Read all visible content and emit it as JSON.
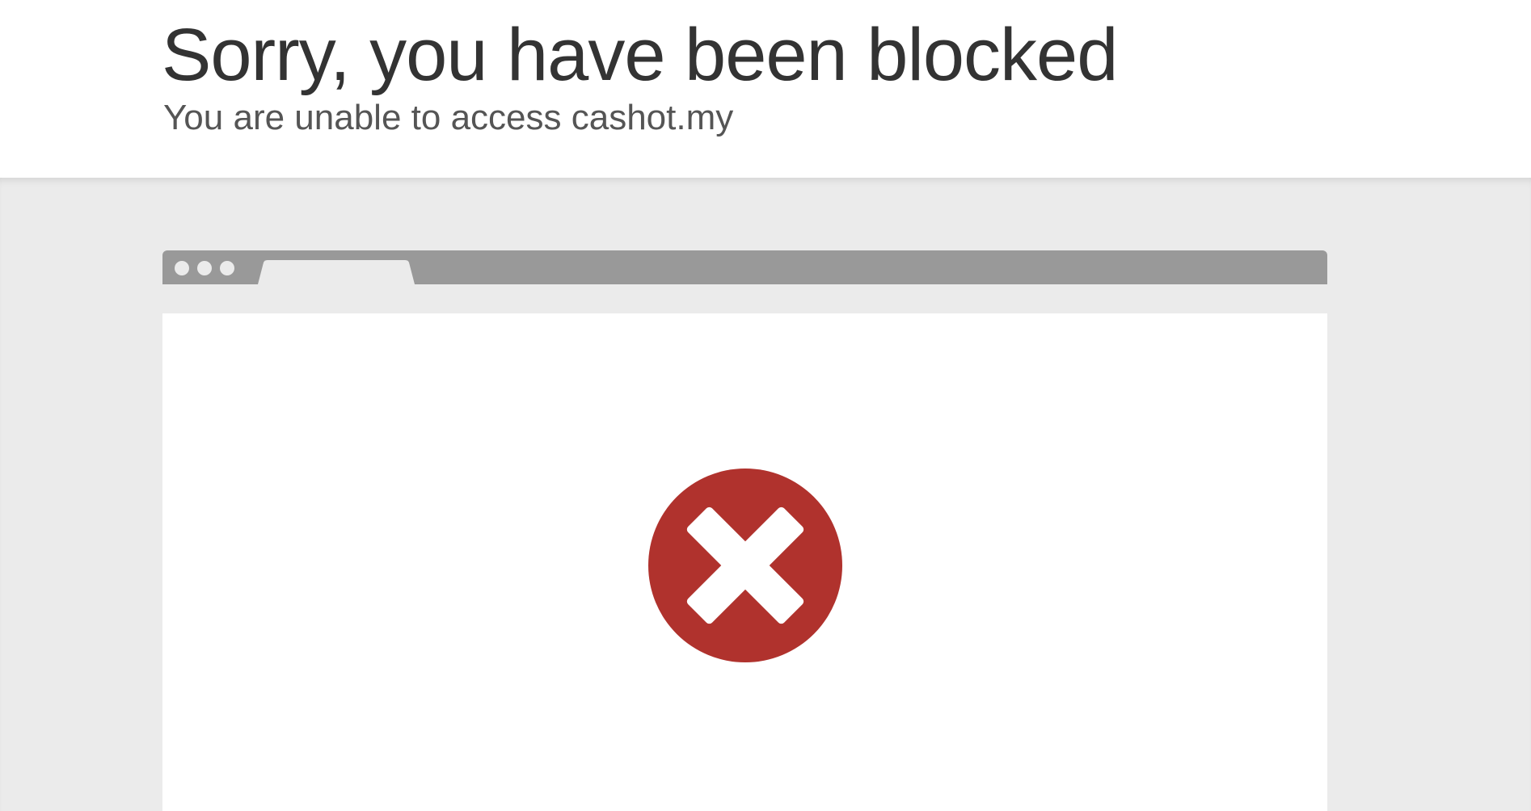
{
  "header": {
    "title": "Sorry, you have been blocked",
    "subtitle": "You are unable to access cashot.my"
  },
  "browser_illustration": {
    "bar_color": "#999999",
    "content_color": "#ffffff",
    "background_color": "#ebebeb"
  },
  "error_icon": {
    "icon": "close-icon",
    "circle_color": "#b0322d",
    "cross_color": "#ffffff"
  }
}
